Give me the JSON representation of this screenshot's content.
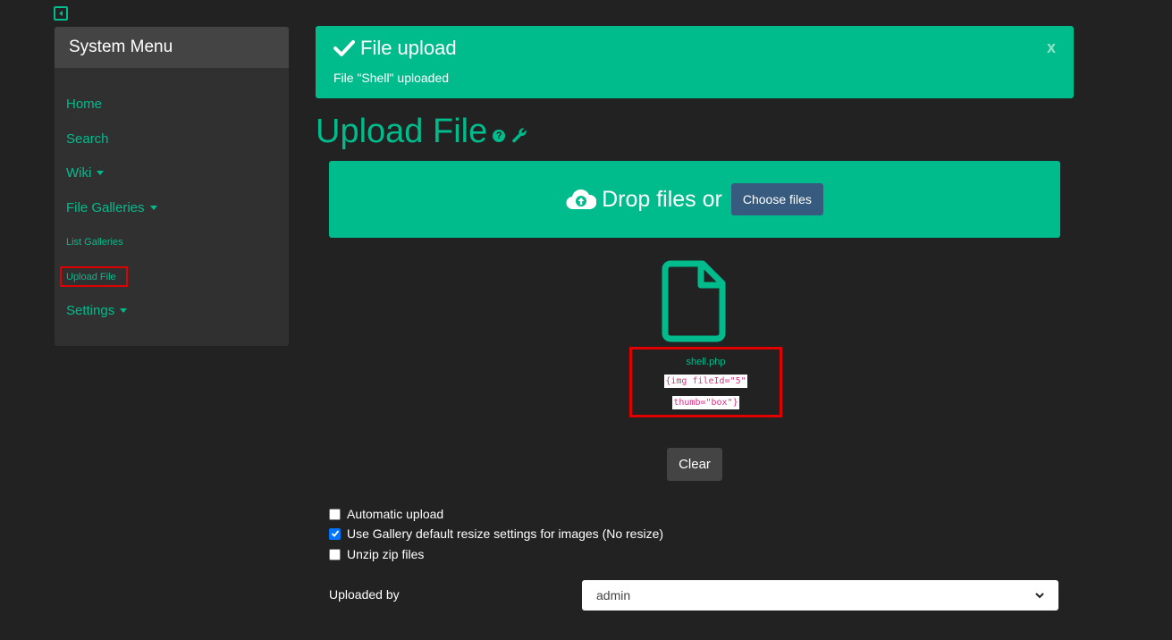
{
  "sidebar": {
    "title": "System Menu",
    "items": [
      {
        "label": "Home",
        "has_caret": false,
        "small": false
      },
      {
        "label": "Search",
        "has_caret": false,
        "small": false
      },
      {
        "label": "Wiki",
        "has_caret": true,
        "small": false
      },
      {
        "label": "File Galleries",
        "has_caret": true,
        "small": false
      },
      {
        "label": "List Galleries",
        "has_caret": false,
        "small": true
      },
      {
        "label": "Upload File",
        "has_caret": false,
        "small": true
      },
      {
        "label": "Settings",
        "has_caret": true,
        "small": false
      }
    ]
  },
  "alert": {
    "title": "File upload",
    "message": "File \"Shell\" uploaded",
    "close": "x"
  },
  "page": {
    "title": "Upload File"
  },
  "dropzone": {
    "text": "Drop files or",
    "button": "Choose files"
  },
  "file": {
    "name": "shell.php",
    "code_line1": "{img fileId=\"5\"",
    "code_line2": "thumb=\"box\"}"
  },
  "clear_button": "Clear",
  "options": [
    {
      "label": "Automatic upload",
      "checked": false
    },
    {
      "label": "Use Gallery default resize settings for images (No resize)",
      "checked": true
    },
    {
      "label": "Unzip zip files",
      "checked": false
    }
  ],
  "uploaded_by": {
    "label": "Uploaded by",
    "value": "admin"
  },
  "colors": {
    "accent": "#00bc8c",
    "background": "#222222",
    "highlight": "#e00000",
    "button_primary": "#375a7f"
  }
}
